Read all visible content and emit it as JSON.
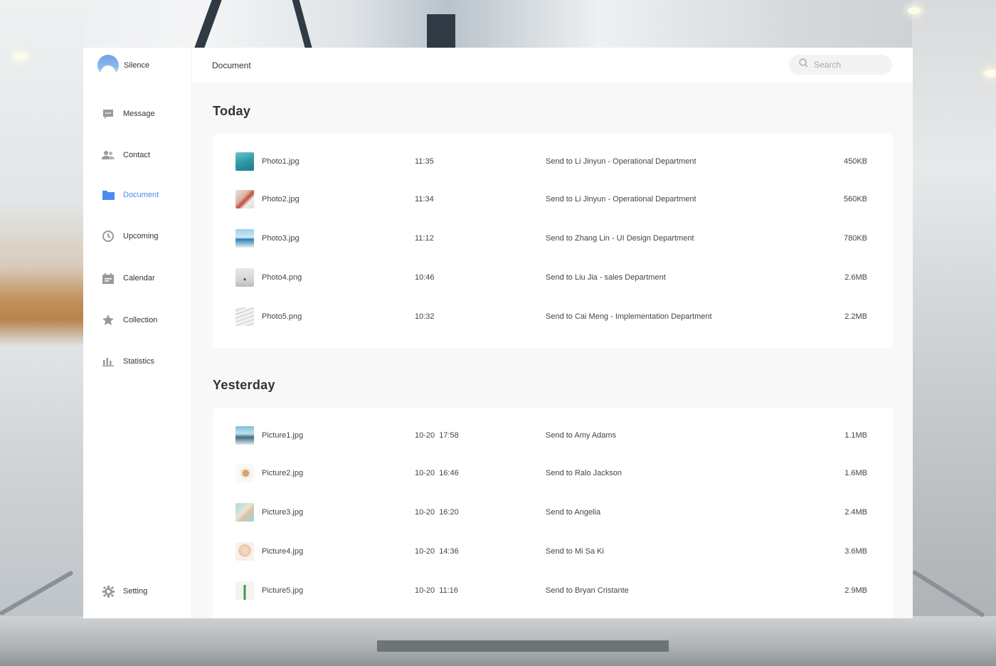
{
  "profile": {
    "name": "Silence"
  },
  "nav": [
    {
      "label": "Message"
    },
    {
      "label": "Contact"
    },
    {
      "label": "Document"
    },
    {
      "label": "Upcoming"
    },
    {
      "label": "Calendar"
    },
    {
      "label": "Collection"
    },
    {
      "label": "Statistics"
    }
  ],
  "settings_label": "Setting",
  "topbar": {
    "title": "Document",
    "search_placeholder": "Search"
  },
  "accent_color": "#4a8bf0",
  "sections": [
    {
      "title": "Today",
      "files": [
        {
          "name": "Photo1.jpg",
          "time": "11:35",
          "destination": "Send to Li Jinyun - Operational Department",
          "size": "450KB"
        },
        {
          "name": "Photo2.jpg",
          "time": "11:34",
          "destination": "Send to Li Jinyun - Operational Department",
          "size": "560KB"
        },
        {
          "name": "Photo3.jpg",
          "time": "11:12",
          "destination": "Send to Zhang Lin - UI Design Department",
          "size": "780KB"
        },
        {
          "name": "Photo4.png",
          "time": "10:46",
          "destination": "Send to Liu Jia - sales Department",
          "size": "2.6MB"
        },
        {
          "name": "Photo5.png",
          "time": "10:32",
          "destination": "Send to Cai Meng - Implementation Department",
          "size": "2.2MB"
        }
      ]
    },
    {
      "title": "Yesterday",
      "files": [
        {
          "name": "Picture1.jpg",
          "time": "10-20 17:58",
          "destination": "Send to Amy Adams",
          "size": "1.1MB"
        },
        {
          "name": "Picture2.jpg",
          "time": "10-20 16:46",
          "destination": "Send to Ralo Jackson",
          "size": "1.6MB"
        },
        {
          "name": "Picture3.jpg",
          "time": "10-20 16:20",
          "destination": "Send to Angelia",
          "size": "2.4MB"
        },
        {
          "name": "Picture4.jpg",
          "time": "10-20 14:36",
          "destination": "Send to Mi Sa Ki",
          "size": "3.6MB"
        },
        {
          "name": "Picture5.jpg",
          "time": "10-20 11:16",
          "destination": "Send to Bryan Cristante",
          "size": "2.9MB"
        }
      ]
    }
  ]
}
